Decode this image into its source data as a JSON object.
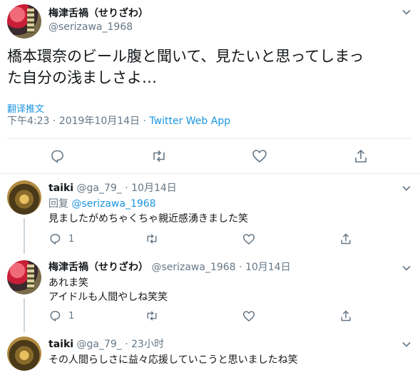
{
  "main_tweet": {
    "display_name": "梅津舌禍（せりざわ）",
    "handle": "@serizawa_1968",
    "text_line1": "橋本環奈のビール腹と聞いて、見たいと思ってしまっ",
    "text_line2": "た自分の浅ましさよ…",
    "translate_label": "翻译推文",
    "timestamp": "下午4:23 · 2019年10月14日 · ",
    "source": "Twitter Web App"
  },
  "replies": [
    {
      "display_name": "taiki",
      "handle": "@ga_79_",
      "time": "· 10月14日",
      "reply_to_prefix": "回复 ",
      "reply_to_handle": "@serizawa_1968",
      "text_lines": [
        "見ましたがめちゃくちゃ親近感湧きました笑"
      ],
      "reply_count": "1"
    },
    {
      "display_name": "梅津舌禍（せりざわ）",
      "handle": "@serizawa_1968",
      "time": "· 10月14日",
      "text_lines": [
        "あれま笑",
        "アイドルも人間やしね笑笑"
      ],
      "reply_count": "1"
    },
    {
      "display_name": "taiki",
      "handle": "@ga_79_",
      "time": "· 23小时",
      "text_lines": [
        "その人間らしさに益々応援していこうと思いましたね笑"
      ]
    }
  ],
  "icons": {
    "more": "chevron-down-icon",
    "reply": "reply-icon",
    "retweet": "retweet-icon",
    "like": "heart-icon",
    "share": "share-icon"
  },
  "colors": {
    "link": "#1b95e0",
    "muted": "#657786",
    "divider": "#e6ecf0"
  }
}
